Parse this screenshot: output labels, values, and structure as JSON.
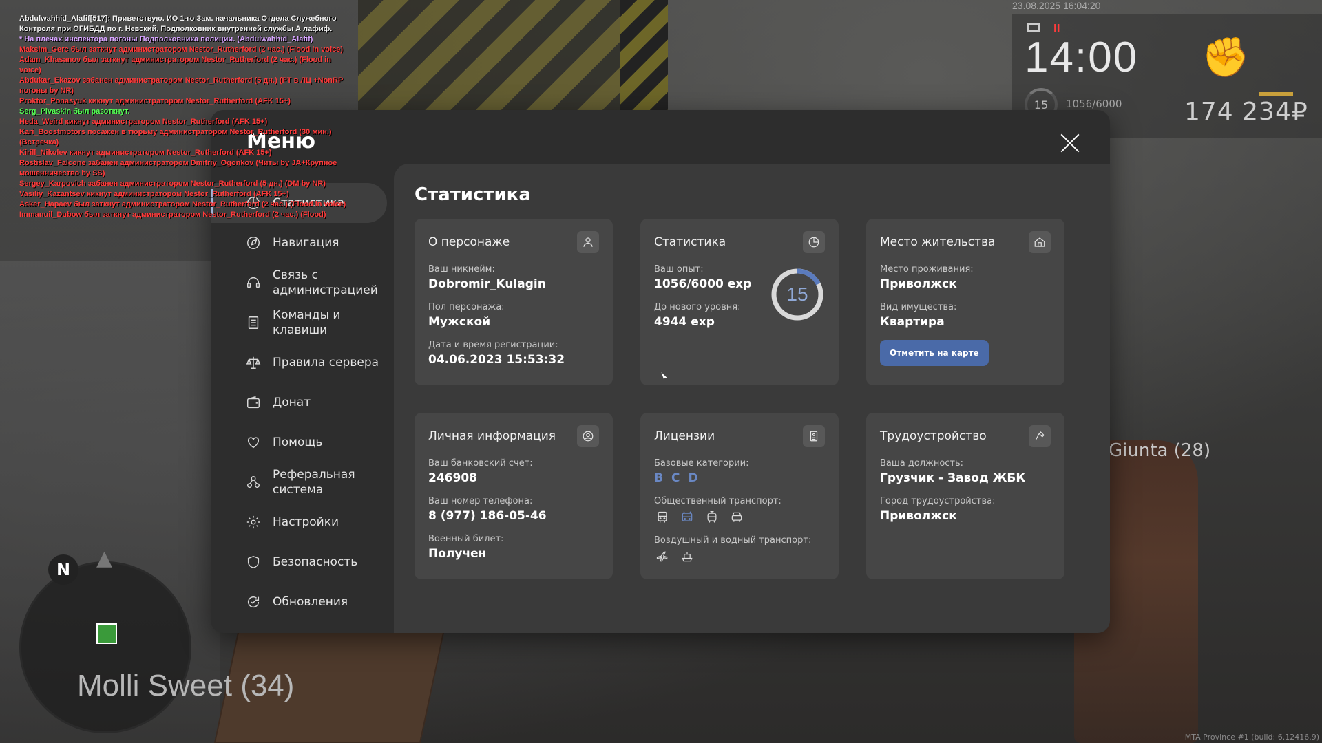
{
  "chat": [
    {
      "text": "Abdulwahhid_Alafif[517]: Приветствую. ИО 1-го Зам. начальника Отдела Служебного Контроля при ОГИБДД по г. Невский, Подполковник внутренней службы А лафиф.",
      "color": "white"
    },
    {
      "text": "* На плечах инспектора погоны Подполковника полиции. (Abdulwahhid_Alafif)",
      "color": "purple"
    },
    {
      "text": "Maksim_Gerc был заткнут администратором Nestor_Rutherford (2 час.) (Flood in voice)",
      "color": "red"
    },
    {
      "text": "Adam_Khasanov был заткнут администратором Nestor_Rutherford (2 час.) (Flood in voice)",
      "color": "red"
    },
    {
      "text": "Abdukar_Ekazov забанен администратором Nestor_Rutherford (5 дн.) (PT в ЛЦ +NonRP погоны by NR)",
      "color": "red"
    },
    {
      "text": "Proktor_Ponasyuk кикнут администратором Nestor_Rutherford (AFK 15+)",
      "color": "red"
    },
    {
      "text": "Serg_Pivaskin был разоткнут.",
      "color": "green"
    },
    {
      "text": "Heda_Weird кикнут администратором Nestor_Rutherford (AFK 15+)",
      "color": "red"
    },
    {
      "text": "Kari_Boostmotors посажен в тюрьму администратором Nestor_Rutherford (30 мин.) (Встречка)",
      "color": "red"
    },
    {
      "text": "Kirill_Nikolev кикнут администратором Nestor_Rutherford (AFK 15+)",
      "color": "red"
    },
    {
      "text": "Rostislav_Falcone забанен администратором Dmitriy_Ogonkov (Читы by JA+Крупное мошенничество by SS)",
      "color": "red"
    },
    {
      "text": "Sergey_Karpovich забанен администратором Nestor_Rutherford (5 дн.) (DM by NR)",
      "color": "red"
    },
    {
      "text": "Vasiliy_Kazantsev кикнут администратором Nestor_Rutherford (AFK 15+)",
      "color": "red"
    },
    {
      "text": "Asker_Hapaev был заткнут администратором Nestor_Rutherford (2 час.) (Flood in voice)",
      "color": "red"
    },
    {
      "text": "Immanuil_Dubow был заткнут администратором Nestor_Rutherford (2 час.) (Flood)",
      "color": "red"
    }
  ],
  "hud": {
    "datetime": "23.08.2025 16:04:20",
    "time": "14:00",
    "level": "15",
    "exp": "1056/6000",
    "money": "174 234₽",
    "pause_icon": "ll",
    "nearby_player": "Giunta (28)",
    "player_name": "Molli Sweet (34)",
    "compass": "N",
    "build": "MTA Province #1 (build: 6.12416.9)"
  },
  "menu": {
    "title": "Меню",
    "nav": [
      {
        "label": "Статистика",
        "icon": "stats-icon",
        "active": true
      },
      {
        "label": "Навигация",
        "icon": "navigation-icon"
      },
      {
        "label": "Связь с администрацией",
        "icon": "headset-icon"
      },
      {
        "label": "Команды и клавиши",
        "icon": "commands-icon"
      },
      {
        "label": "Правила сервера",
        "icon": "scales-icon"
      },
      {
        "label": "Донат",
        "icon": "wallet-icon"
      },
      {
        "label": "Помощь",
        "icon": "help-heart-icon"
      },
      {
        "label": "Реферальная система",
        "icon": "referral-icon"
      },
      {
        "label": "Настройки",
        "icon": "gear-icon"
      },
      {
        "label": "Безопасность",
        "icon": "shield-icon"
      },
      {
        "label": "Обновления",
        "icon": "updates-icon"
      }
    ]
  },
  "stats": {
    "section_title": "Статистика",
    "character": {
      "title": "О персонаже",
      "nickname_label": "Ваш никнейм:",
      "nickname": "Dobromir_Kulagin",
      "gender_label": "Пол персонажа:",
      "gender": "Мужской",
      "reg_label": "Дата и время регистрации:",
      "reg": "04.06.2023 15:53:32"
    },
    "experience": {
      "title": "Статистика",
      "exp_label": "Ваш опыт:",
      "exp": "1056/6000 exp",
      "next_label": "До нового уровня:",
      "next": "4944 exp",
      "level": "15",
      "progress": 0.176
    },
    "residence": {
      "title": "Место жительства",
      "place_label": "Место проживания:",
      "place": "Приволжск",
      "property_label": "Вид имущества:",
      "property": "Квартира",
      "button": "Отметить на карте"
    },
    "personal": {
      "title": "Личная информация",
      "bank_label": "Ваш банковский счет:",
      "bank": "246908",
      "phone_label": "Ваш номер телефона:",
      "phone": "8 (977) 186-05-46",
      "military_label": "Военный билет:",
      "military": "Получен"
    },
    "licenses": {
      "title": "Лицензии",
      "base_label": "Базовые категории:",
      "base": [
        "B",
        "C",
        "D"
      ],
      "public_label": "Общественный транспорт:",
      "public_icons": [
        "bus-icon",
        "trolleybus-icon",
        "tram-icon",
        "cab-icon"
      ],
      "public_active": "trolleybus-icon",
      "air_label": "Воздушный и водный транспорт:",
      "air_icons": [
        "plane-icon",
        "boat-icon"
      ]
    },
    "job": {
      "title": "Трудоустройство",
      "position_label": "Ваша должность:",
      "position": "Грузчик - Завод ЖБК",
      "city_label": "Город трудоустройства:",
      "city": "Приволжск"
    }
  },
  "colors": {
    "accent": "#4a6aa8",
    "accent_text": "#6a88c4",
    "panel": "#2d2d2d",
    "content": "#3a3a3a",
    "card": "#464646"
  }
}
